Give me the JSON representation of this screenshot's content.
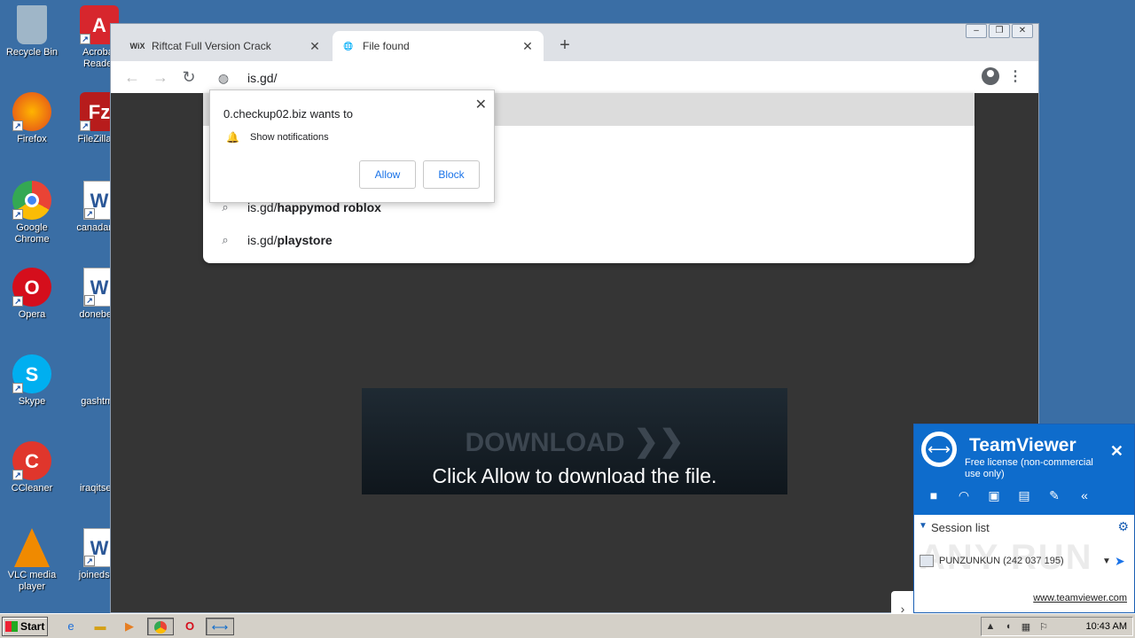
{
  "desktop": {
    "icons": [
      {
        "label": "Recycle Bin"
      },
      {
        "label": "Acrobat Reader"
      },
      {
        "label": "Firefox"
      },
      {
        "label": "FileZilla C"
      },
      {
        "label": "Google Chrome"
      },
      {
        "label": "canadame"
      },
      {
        "label": "Opera"
      },
      {
        "label": "donebest"
      },
      {
        "label": "Skype"
      },
      {
        "label": "gashtml."
      },
      {
        "label": "CCleaner"
      },
      {
        "label": "iraqitself."
      },
      {
        "label": "VLC media player"
      },
      {
        "label": "joinedsuit"
      }
    ]
  },
  "browser": {
    "tabs": [
      {
        "favicon": "WiX",
        "title": "Riftcat Full Version Crack",
        "close": "✕"
      },
      {
        "favicon": "globe-icon",
        "title": "File found",
        "close": "✕"
      }
    ],
    "new_tab": "+",
    "address": "is.gd/",
    "suggestions": [
      {
        "prefix": "is.gd/",
        "bold": "happymod roblox"
      },
      {
        "prefix": "is.gd/",
        "bold": "playstore"
      }
    ],
    "permission": {
      "title": "0.checkup02.biz wants to",
      "item": "Show notifications",
      "allow": "Allow",
      "block": "Block"
    },
    "banner": {
      "heading": "DOWNLOAD",
      "message": "Click Allow to download the file."
    }
  },
  "teamviewer": {
    "name": "TeamViewer",
    "license": "Free license (non-commercial use only)",
    "session_list": "Session list",
    "entry": "PUNZUNKUN (242 037 195)",
    "link": "www.teamviewer.com",
    "watermark": "ANY RUN"
  },
  "taskbar": {
    "start": "Start",
    "clock": "10:43 AM"
  }
}
